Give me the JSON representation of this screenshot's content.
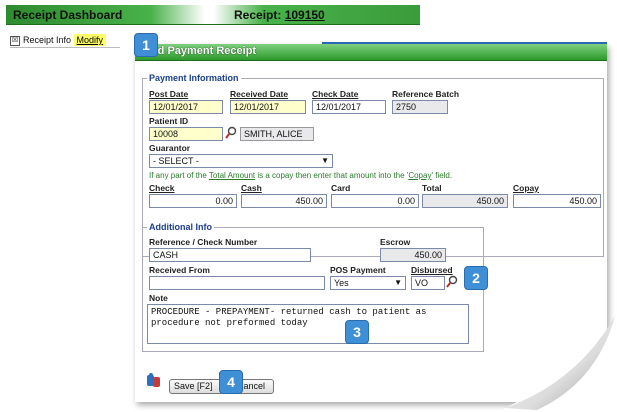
{
  "header": {
    "title": "Receipt Dashboard",
    "receipt_label": "Receipt: ",
    "receipt_number": "109150"
  },
  "info_bar": {
    "toggle": "☒",
    "label": "Receipt Info",
    "modify": "Modify"
  },
  "dialog": {
    "title": "Add Payment Receipt"
  },
  "payment_info": {
    "legend": "Payment Information",
    "post_date_label": "Post Date",
    "post_date": "12/01/2017",
    "received_date_label": "Received Date",
    "received_date": "12/01/2017",
    "check_date_label": "Check Date",
    "check_date": "12/01/2017",
    "reference_batch_label": "Reference Batch",
    "reference_batch": "2750",
    "patient_id_label": "Patient ID",
    "patient_id": "10008",
    "patient_name": "SMITH, ALICE",
    "guarantor_label": "Guarantor",
    "guarantor_value": "- SELECT -",
    "copay_note_1": "If any part of the ",
    "copay_note_link1": "Total Amount",
    "copay_note_2": " is a copay then enter that amount into the '",
    "copay_note_link2": "Copay",
    "copay_note_3": "' field.",
    "check_label": "Check",
    "check_value": "0.00",
    "cash_label": "Cash",
    "cash_value": "450.00",
    "card_label": "Card",
    "card_value": "0.00",
    "total_label": "Total",
    "total_value": "450.00",
    "copay_label": "Copay",
    "copay_value": "450.00"
  },
  "additional_info": {
    "legend": "Additional Info",
    "reference_label": "Reference / Check Number",
    "reference_value": "CASH",
    "escrow_label": "Escrow",
    "escrow_value": "450.00",
    "received_from_label": "Received From",
    "received_from_value": "",
    "pos_payment_label": "POS Payment",
    "pos_payment_value": "Yes",
    "disbursed_label": "Disbursed",
    "disbursed_value": "VO",
    "note_label": "Note",
    "note_value": "PROCEDURE - PREPAYMENT- returned cash to patient as procedure not preformed today"
  },
  "buttons": {
    "save": "Save [F2]",
    "cancel": "Cancel"
  },
  "callouts": [
    "1",
    "2",
    "3",
    "4"
  ],
  "colors": {
    "header_green": "#49b24a",
    "callout_blue": "#3f8fd6",
    "input_yellow": "#ffffcc",
    "note_green": "#2c7b2c"
  }
}
